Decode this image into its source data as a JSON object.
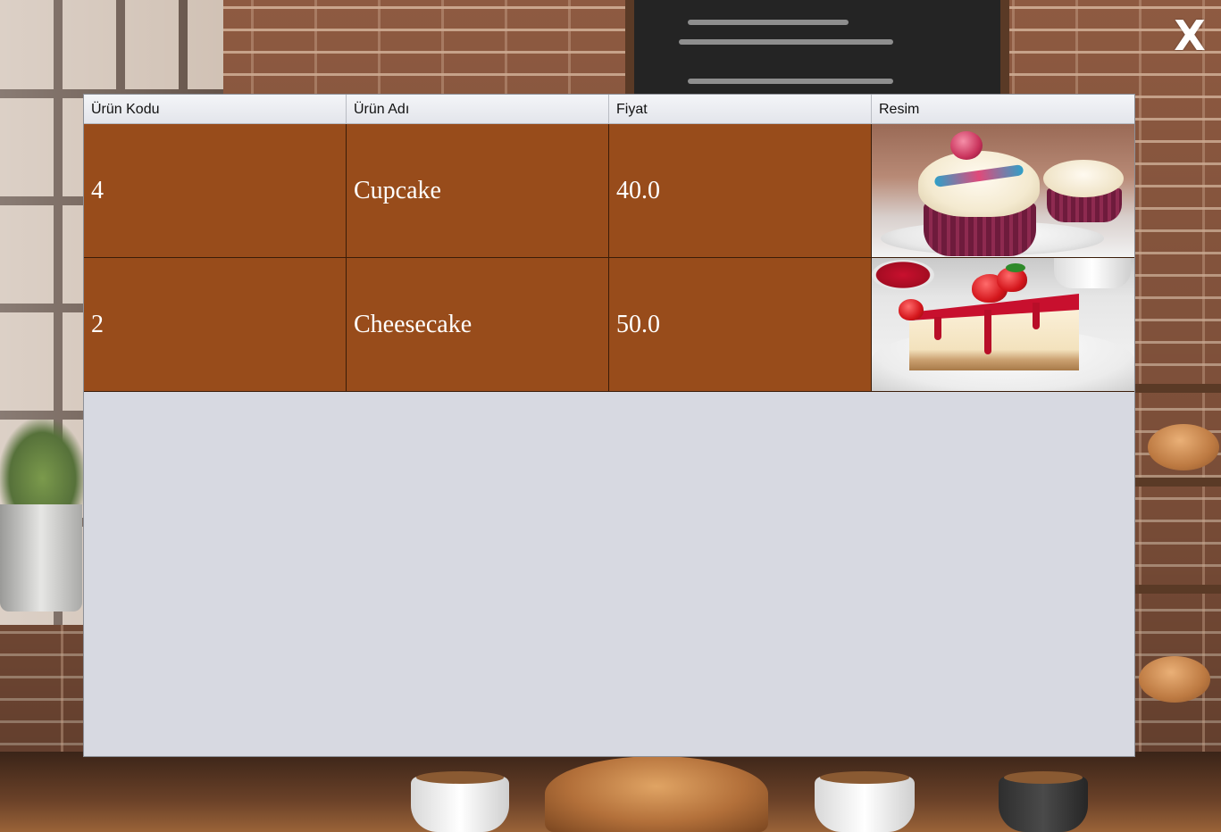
{
  "window": {
    "close_label": "X"
  },
  "table": {
    "columns": [
      "Ürün Kodu",
      "Ürün Adı",
      "Fiyat",
      "Resim"
    ],
    "rows": [
      {
        "code": "4",
        "name": "Cupcake",
        "price": "40.0",
        "image_icon": "cupcake-photo"
      },
      {
        "code": "2",
        "name": "Cheesecake",
        "price": "50.0",
        "image_icon": "cheesecake-photo"
      }
    ]
  },
  "colors": {
    "row_background": "#984c1b",
    "panel_background": "#d7d9e1",
    "header_background": "#e9eaef",
    "cell_text": "#ffffff"
  }
}
